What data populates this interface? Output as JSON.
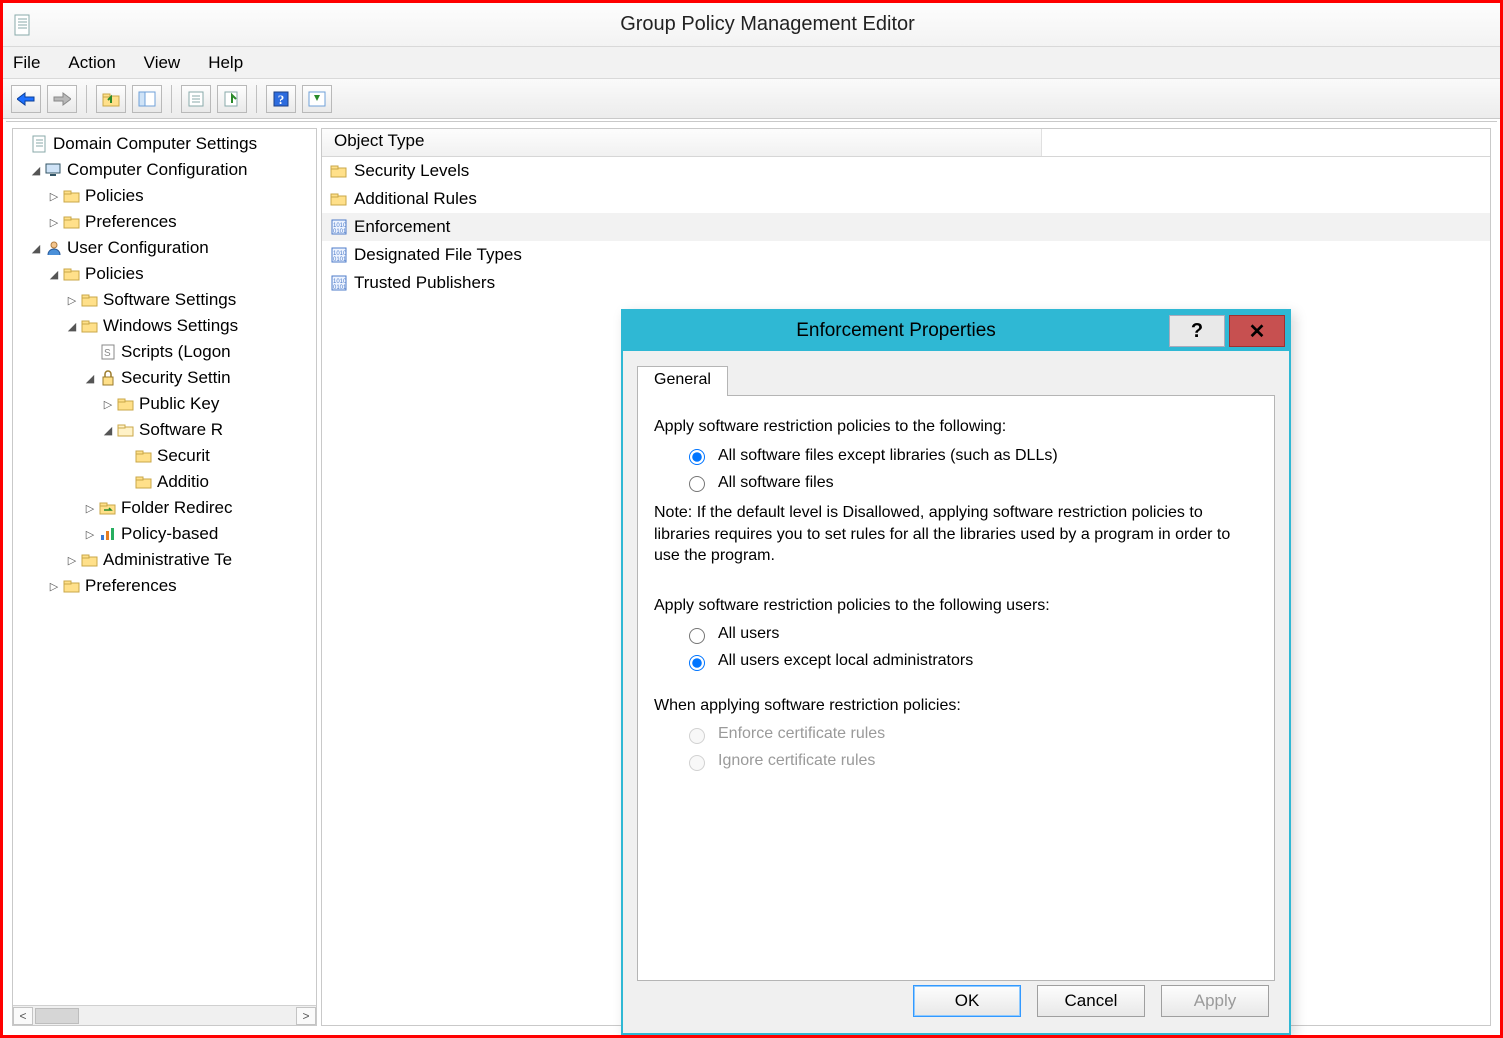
{
  "window": {
    "title": "Group Policy Management Editor"
  },
  "menubar": {
    "file": "File",
    "action": "Action",
    "view": "View",
    "help": "Help"
  },
  "tree": {
    "root": "Domain Computer Settings",
    "computer_config": "Computer Configuration",
    "cc_policies": "Policies",
    "cc_prefs": "Preferences",
    "user_config": "User Configuration",
    "uc_policies": "Policies",
    "uc_software": "Software Settings",
    "uc_windows": "Windows Settings",
    "uc_scripts": "Scripts (Logon",
    "uc_security": "Security Settin",
    "uc_pubkey": "Public Key",
    "uc_swrestrict": "Software R",
    "uc_seclevels": "Securit",
    "uc_addrules": "Additio",
    "uc_folder": "Folder Redirec",
    "uc_policybased": "Policy-based",
    "uc_admin": "Administrative Te",
    "uc_prefs": "Preferences"
  },
  "list": {
    "header": "Object Type",
    "items": [
      {
        "label": "Security Levels",
        "icon": "folder"
      },
      {
        "label": "Additional Rules",
        "icon": "folder"
      },
      {
        "label": "Enforcement",
        "icon": "props",
        "selected": true
      },
      {
        "label": "Designated File Types",
        "icon": "props"
      },
      {
        "label": "Trusted Publishers",
        "icon": "props"
      }
    ]
  },
  "dialog": {
    "title": "Enforcement Properties",
    "tab": "General",
    "group1_label": "Apply software restriction policies to the following:",
    "opt_files_except_libs": "All software files except libraries (such as DLLs)",
    "opt_all_files": "All software files",
    "note": "Note:  If the default level is Disallowed, applying software restriction policies to libraries requires you to set rules for all the libraries used by a program in order to use the program.",
    "group2_label": "Apply software restriction policies to the following users:",
    "opt_all_users": "All users",
    "opt_users_except_admins": "All users except local administrators",
    "group3_label": "When applying software restriction policies:",
    "opt_enforce_cert": "Enforce certificate rules",
    "opt_ignore_cert": "Ignore certificate rules",
    "btn_ok": "OK",
    "btn_cancel": "Cancel",
    "btn_apply": "Apply"
  }
}
